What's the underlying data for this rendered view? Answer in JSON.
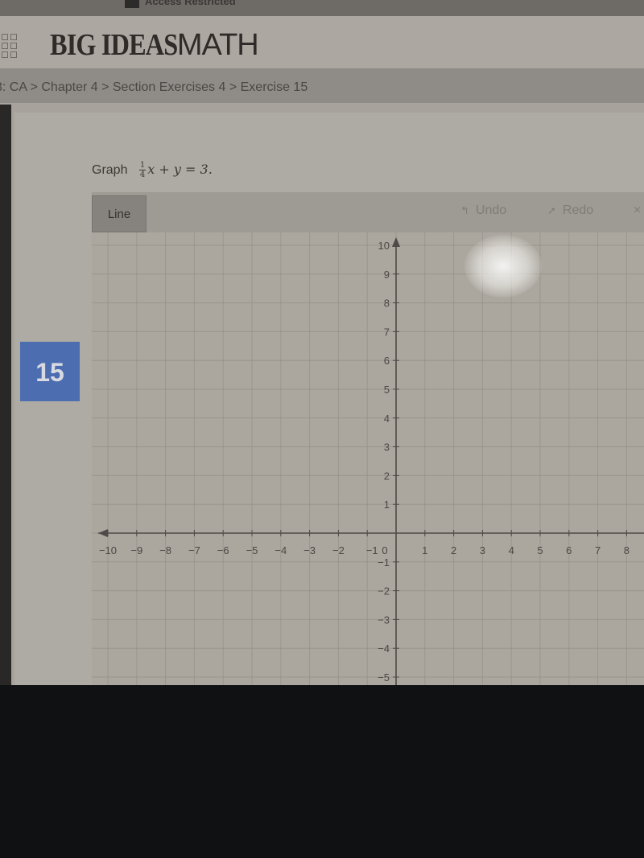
{
  "topbar": {
    "text": "Access Restricted"
  },
  "header": {
    "logo_bold": "BIG IDEAS",
    "logo_light": "MATH"
  },
  "breadcrumb": {
    "items": [
      "3: CA",
      "Chapter 4",
      "Section Exercises 4",
      "Exercise 15"
    ],
    "separator": " > "
  },
  "exercise": {
    "number": "15",
    "prompt_label": "Graph",
    "equation": {
      "numerator": "1",
      "denominator": "4",
      "rest": "x + y = 3."
    }
  },
  "toolbar": {
    "line_label": "Line",
    "undo_label": "Undo",
    "redo_label": "Redo",
    "close_glyph": "×",
    "undo_icon": "undo-arrow-icon",
    "redo_icon": "redo-arrow-icon"
  },
  "colors": {
    "badge": "#4c6db0",
    "axis": "#4d4a47",
    "grid": "#948f88"
  },
  "chart_data": {
    "type": "scatter",
    "title": "",
    "xlabel": "",
    "ylabel": "",
    "xlim": [
      -10,
      8
    ],
    "ylim": [
      -5,
      10
    ],
    "grid": true,
    "x_ticks": [
      "-10",
      "-9",
      "-8",
      "-7",
      "-6",
      "-5",
      "-4",
      "-3",
      "-2",
      "-1",
      "0",
      "1",
      "2",
      "3",
      "4",
      "5",
      "6",
      "7",
      "8"
    ],
    "y_ticks": [
      "-5",
      "-4",
      "-3",
      "-2",
      "-1",
      "1",
      "2",
      "3",
      "4",
      "5",
      "6",
      "7",
      "8",
      "9",
      "10"
    ],
    "series": []
  }
}
